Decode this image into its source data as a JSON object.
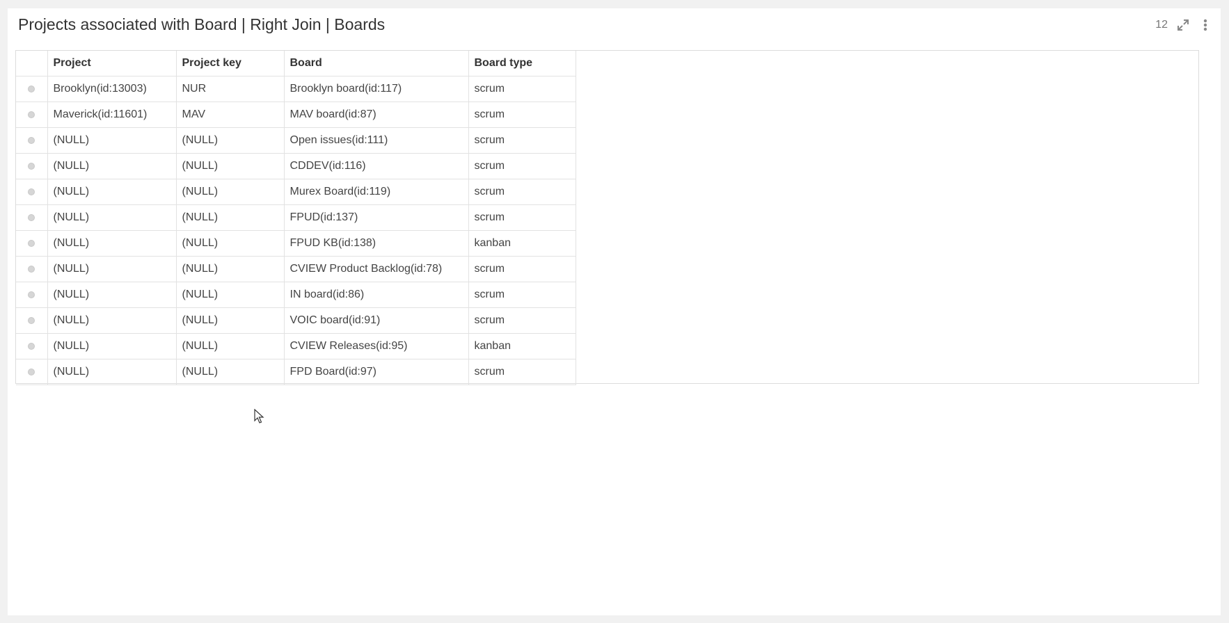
{
  "panel": {
    "title": "Projects associated with Board | Right Join | Boards",
    "row_count": "12",
    "icons": [
      "expand-icon",
      "more-vertical-icon"
    ]
  },
  "table": {
    "headers": [
      "Project",
      "Project key",
      "Board",
      "Board type"
    ],
    "rows": [
      {
        "project": "Brooklyn(id:13003)",
        "key": "NUR",
        "board": "Brooklyn board(id:117)",
        "type": "scrum"
      },
      {
        "project": "Maverick(id:11601)",
        "key": "MAV",
        "board": "MAV board(id:87)",
        "type": "scrum"
      },
      {
        "project": "(NULL)",
        "key": "(NULL)",
        "board": "Open issues(id:111)",
        "type": "scrum"
      },
      {
        "project": "(NULL)",
        "key": "(NULL)",
        "board": "CDDEV(id:116)",
        "type": "scrum"
      },
      {
        "project": "(NULL)",
        "key": "(NULL)",
        "board": "Murex Board(id:119)",
        "type": "scrum"
      },
      {
        "project": "(NULL)",
        "key": "(NULL)",
        "board": "FPUD(id:137)",
        "type": "scrum"
      },
      {
        "project": "(NULL)",
        "key": "(NULL)",
        "board": "FPUD KB(id:138)",
        "type": "kanban"
      },
      {
        "project": "(NULL)",
        "key": "(NULL)",
        "board": "CVIEW Product Backlog(id:78)",
        "type": "scrum"
      },
      {
        "project": "(NULL)",
        "key": "(NULL)",
        "board": "IN board(id:86)",
        "type": "scrum"
      },
      {
        "project": "(NULL)",
        "key": "(NULL)",
        "board": "VOIC board(id:91)",
        "type": "scrum"
      },
      {
        "project": "(NULL)",
        "key": "(NULL)",
        "board": "CVIEW Releases(id:95)",
        "type": "kanban"
      },
      {
        "project": "(NULL)",
        "key": "(NULL)",
        "board": "FPD Board(id:97)",
        "type": "scrum"
      }
    ]
  },
  "colors": {
    "page_background": "#f1f1f1",
    "panel_background": "#ffffff",
    "grid_line": "#e2e2e2",
    "radio_fill": "#d6d6d6"
  }
}
